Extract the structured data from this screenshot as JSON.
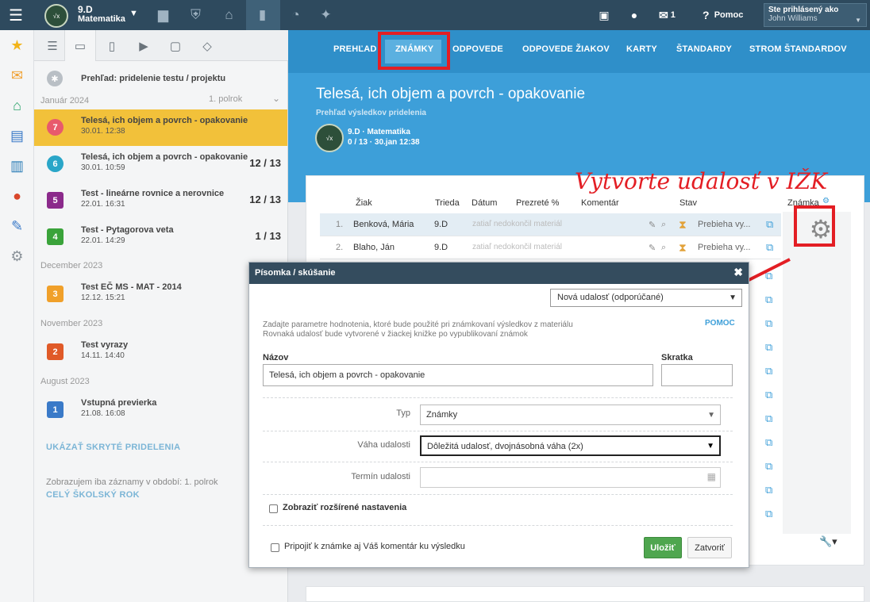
{
  "topbar": {
    "class_name": "9.D",
    "class_subject": "Matematika",
    "help_label": "Pomoc",
    "messages_count": "1",
    "login_label": "Ste prihlásený ako",
    "login_user": "John Williams"
  },
  "sidebar": {
    "overview_label": "Prehľad: pridelenie testu / projektu",
    "period_label": "1. polrok",
    "months": [
      "Január 2024",
      "December 2023",
      "November 2023",
      "August 2023"
    ],
    "items": [
      {
        "badge": "7",
        "title": "Telesá, ich objem a povrch - opakovanie",
        "date": "30.01. 12:38",
        "count": "",
        "color": "#e85a6c"
      },
      {
        "badge": "6",
        "title": "Telesá, ich objem a povrch - opakovanie",
        "date": "30.01. 10:59",
        "count": "12 / 13",
        "color": "#2aa6c8"
      },
      {
        "badge": "5",
        "title": "Test - lineárne rovnice a nerovnice",
        "date": "22.01. 16:31",
        "count": "12 / 13",
        "color": "#8b2a8b"
      },
      {
        "badge": "4",
        "title": "Test - Pytagorova veta",
        "date": "22.01. 14:29",
        "count": "1 / 13",
        "color": "#3aa33a"
      },
      {
        "badge": "3",
        "title": "Test EČ MS - MAT - 2014",
        "date": "12.12. 15:21",
        "count": "",
        "color": "#f0a02a"
      },
      {
        "badge": "2",
        "title": "Test vyrazy",
        "date": "14.11. 14:40",
        "count": "",
        "color": "#e05a28"
      },
      {
        "badge": "1",
        "title": "Vstupná previerka",
        "date": "21.08. 16:08",
        "count": "",
        "color": "#3a7ac8"
      }
    ],
    "show_hidden": "UKÁZAŤ SKRYTÉ PRIDELENIA",
    "period_note": "Zobrazujem iba záznamy v období: 1. polrok",
    "whole_year": "CELÝ ŠKOLSKÝ ROK"
  },
  "nav": {
    "tabs": [
      "PREHĽAD",
      "ZNÁMKY",
      "ODPOVEDE",
      "ODPOVEDE ŽIAKOV",
      "KARTY",
      "ŠTANDARDY",
      "STROM ŠTANDARDOV"
    ],
    "active": "ZNÁMKY"
  },
  "hero": {
    "title": "Telesá, ich objem a povrch - opakovanie",
    "subtitle": "Prehľad výsledkov pridelenia",
    "class_line": "9.D · Matematika",
    "meta_line": "0 / 13 · 30.jan 12:38"
  },
  "table": {
    "headers": [
      "Žiak",
      "Trieda",
      "Dátum",
      "Prezreté %",
      "Komentár",
      "Stav",
      "Známka"
    ],
    "rows": [
      {
        "num": "1.",
        "name": "Benková, Mária",
        "class": "9.D",
        "status_note": "zatiaľ nedokončil materiál",
        "state": "Prebieha vy..."
      },
      {
        "num": "2.",
        "name": "Blaho, Ján",
        "class": "9.D",
        "status_note": "zatiaľ nedokončil materiál",
        "state": "Prebieha vy..."
      }
    ]
  },
  "annotation": "Vytvorte udalosť v IŽK",
  "modal": {
    "title": "Písomka / skúšanie",
    "event_select": "Nová udalosť (odporúčané)",
    "desc1": "Zadajte parametre hodnotenia, ktoré bude použité pri známkovaní výsledkov z materiálu",
    "desc2": "Rovnaká udalosť bude vytvorené v žiackej knižke po vypublikovaní známok",
    "help": "POMOC",
    "name_label": "Názov",
    "name_value": "Telesá, ich objem a povrch - opakovanie",
    "short_label": "Skratka",
    "type_label": "Typ",
    "type_value": "Známky",
    "weight_label": "Váha udalosti",
    "weight_value": "Dôležitá udalosť, dvojnásobná váha (2x)",
    "date_label": "Termín udalosti",
    "advanced_label": "Zobraziť rozšírené nastavenia",
    "attach_comment_label": "Pripojiť k známke aj Váš komentár ku výsledku",
    "save_label": "Uložiť",
    "close_label": "Zatvoriť"
  }
}
